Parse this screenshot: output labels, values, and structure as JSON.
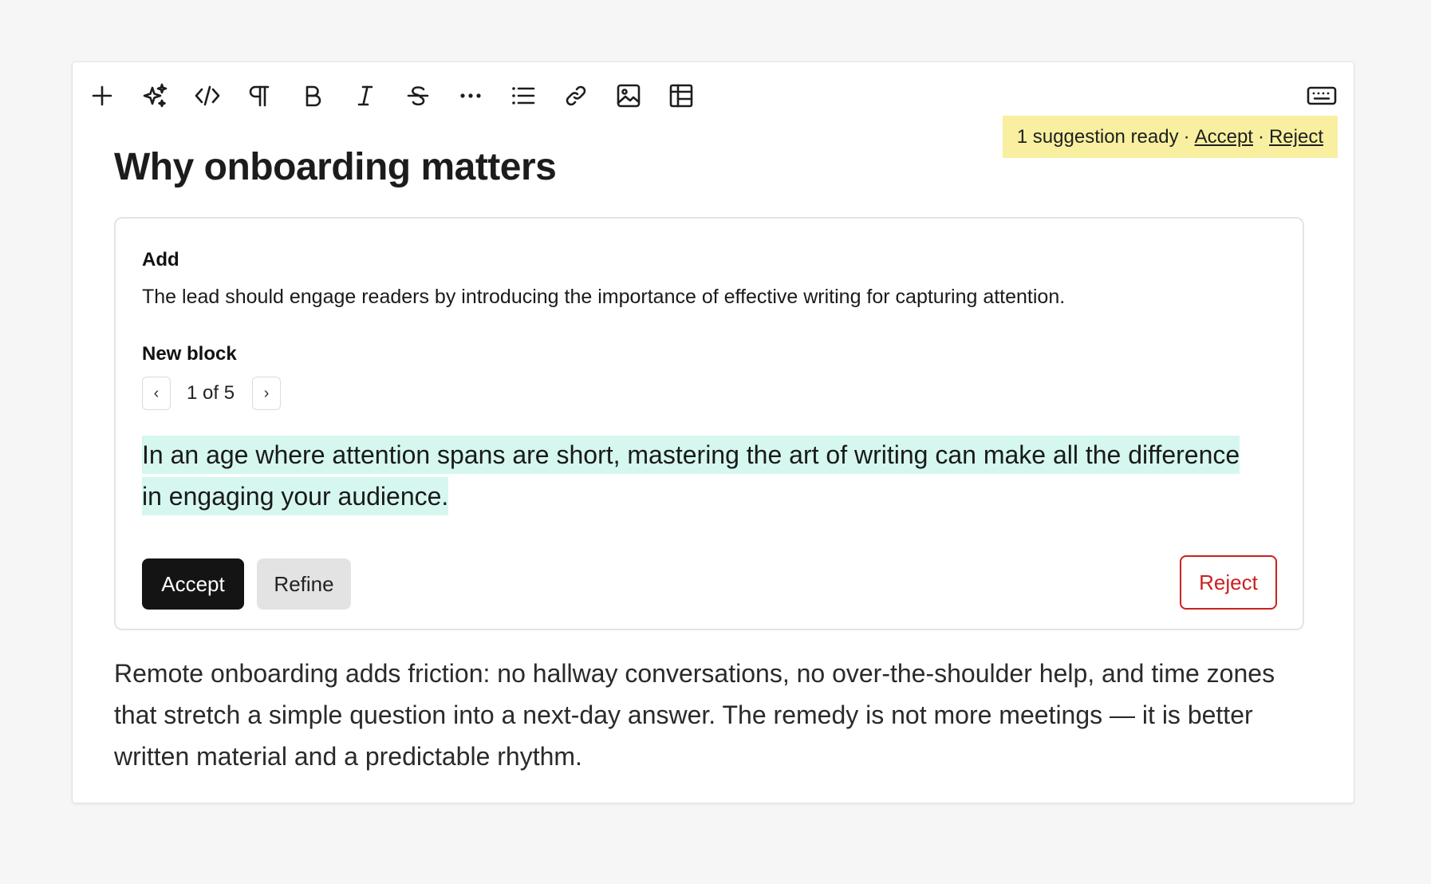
{
  "toolbar": {
    "buttons": [
      {
        "name": "add",
        "icon": "plus-icon"
      },
      {
        "name": "ai",
        "icon": "sparkles-icon"
      },
      {
        "name": "code",
        "icon": "code-icon"
      },
      {
        "name": "paragraph",
        "icon": "pilcrow-icon"
      },
      {
        "name": "bold",
        "icon": "bold-icon"
      },
      {
        "name": "italic",
        "icon": "italic-icon"
      },
      {
        "name": "strikethrough",
        "icon": "strikethrough-icon"
      },
      {
        "name": "more",
        "icon": "ellipsis-icon"
      },
      {
        "name": "list",
        "icon": "list-icon"
      },
      {
        "name": "link",
        "icon": "link-icon"
      },
      {
        "name": "image",
        "icon": "image-icon"
      },
      {
        "name": "table",
        "icon": "table-icon"
      }
    ],
    "keyboard_icon": "keyboard-icon"
  },
  "banner": {
    "text": "1 suggestion ready",
    "separator": "·",
    "accept_label": "Accept",
    "reject_label": "Reject",
    "color": "#f8f0a0"
  },
  "document": {
    "title": "Why onboarding matters",
    "body": "Remote onboarding adds friction: no hallway conversations, no over-the-shoulder help, and time zones that stretch a simple question into a next-day answer. The remedy is not more meetings — it is better written material and a predictable rhythm."
  },
  "suggestion_card": {
    "action_label": "Add",
    "instruction": "The lead should engage readers by introducing the importance of effective writing for capturing attention.",
    "block_label": "New block",
    "pager": {
      "prev": "‹",
      "next": "›",
      "count": "1 of 5"
    },
    "proposed_text": "In an age where attention spans are short, mastering the art of writing can make all the difference in engaging your audience.",
    "highlight_color": "#d5f7ef",
    "accept_label": "Accept",
    "refine_label": "Refine",
    "reject_label": "Reject"
  }
}
